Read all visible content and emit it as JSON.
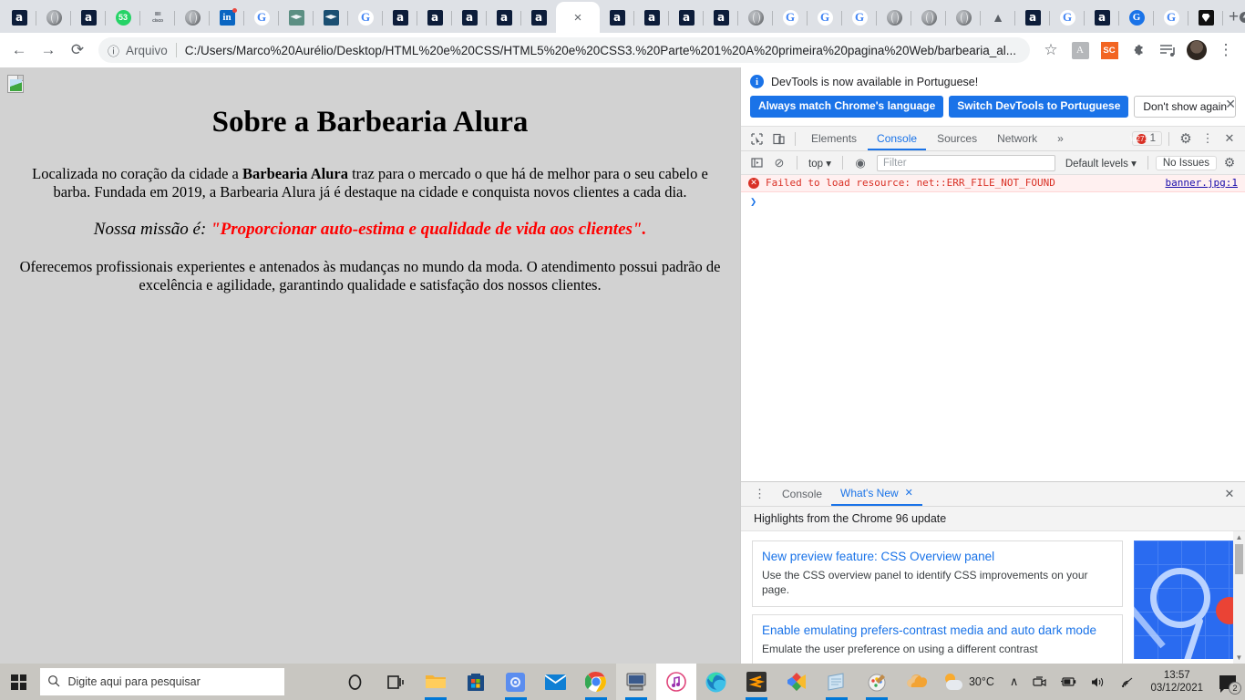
{
  "browser": {
    "tabs": [
      {
        "icon": "alura-favicon",
        "type": "alura",
        "label": "a"
      },
      {
        "icon": "globe-favicon",
        "type": "globe",
        "label": ""
      },
      {
        "icon": "alura-favicon",
        "type": "alura",
        "label": "a"
      },
      {
        "icon": "whatsapp-favicon",
        "type": "wa",
        "label": "53"
      },
      {
        "icon": "cisco-favicon",
        "type": "cisco",
        "label": "cisco"
      },
      {
        "icon": "globe-favicon",
        "type": "globe",
        "label": ""
      },
      {
        "icon": "linkedin-favicon",
        "type": "li",
        "label": "in"
      },
      {
        "icon": "google-favicon",
        "type": "google",
        "label": "G"
      },
      {
        "icon": "graduation-cap-favicon",
        "type": "cap1",
        "label": ""
      },
      {
        "icon": "graduation-cap-favicon",
        "type": "cap2",
        "label": ""
      },
      {
        "icon": "google-favicon",
        "type": "google",
        "label": "G"
      },
      {
        "icon": "alura-favicon",
        "type": "alura",
        "label": "a"
      },
      {
        "icon": "alura-favicon",
        "type": "alura",
        "label": "a"
      },
      {
        "icon": "alura-favicon",
        "type": "alura",
        "label": "a"
      },
      {
        "icon": "alura-favicon",
        "type": "alura",
        "label": "a"
      },
      {
        "icon": "alura-favicon",
        "type": "alura",
        "label": "a"
      },
      {
        "icon": "close-icon",
        "type": "active",
        "label": "×"
      },
      {
        "icon": "alura-favicon",
        "type": "alura",
        "label": "a"
      },
      {
        "icon": "alura-favicon",
        "type": "alura",
        "label": "a"
      },
      {
        "icon": "alura-favicon",
        "type": "alura",
        "label": "a"
      },
      {
        "icon": "alura-favicon",
        "type": "alura",
        "label": "a"
      },
      {
        "icon": "globe-favicon",
        "type": "globe",
        "label": ""
      },
      {
        "icon": "google-favicon",
        "type": "google",
        "label": "G"
      },
      {
        "icon": "google-favicon",
        "type": "google",
        "label": "G"
      },
      {
        "icon": "google-favicon",
        "type": "google",
        "label": "G"
      },
      {
        "icon": "globe-favicon",
        "type": "globe",
        "label": ""
      },
      {
        "icon": "globe-favicon",
        "type": "globe",
        "label": ""
      },
      {
        "icon": "globe-favicon",
        "type": "globe",
        "label": ""
      },
      {
        "icon": "moth-favicon",
        "type": "moth",
        "label": "▲"
      },
      {
        "icon": "alura-favicon",
        "type": "alura",
        "label": "a"
      },
      {
        "icon": "google-favicon",
        "type": "google",
        "label": "G"
      },
      {
        "icon": "alura-favicon",
        "type": "alura",
        "label": "a"
      },
      {
        "icon": "blue-g-favicon",
        "type": "blueg",
        "label": "G"
      },
      {
        "icon": "google-favicon",
        "type": "google",
        "label": "G"
      },
      {
        "icon": "dark-favicon",
        "type": "black",
        "label": ""
      }
    ],
    "new_tab_label": "+",
    "window_controls": {
      "minimize": "–",
      "maximize": "❐",
      "close": "✕"
    },
    "toolbar": {
      "back": "←",
      "forward": "→",
      "reload": "⟳",
      "info_icon": "ⓘ",
      "scheme_label": "Arquivo",
      "url": "C:/Users/Marco%20Aurélio/Desktop/HTML%20e%20CSS/HTML5%20e%20CSS3.%20Parte%201%20A%20primeira%20pagina%20Web/barbearia_al...",
      "bookmark": "☆",
      "ext_pdf": "⇊",
      "ext_sc": "SC",
      "ext_puzzle": "🧩",
      "ext_list": "≡",
      "menu": "⋮"
    }
  },
  "webpage": {
    "heading": "Sobre a Barbearia Alura",
    "paragraph1_a": "Localizada no coração da cidade a ",
    "paragraph1_b": "Barbearia Alura",
    "paragraph1_c": " traz para o mercado o que há de melhor para o seu cabelo e barba. Fundada em 2019, a Barbearia Alura já é destaque na cidade e conquista novos clientes a cada dia.",
    "mission_label": "Nossa missão é: ",
    "mission_quote": "\"Proporcionar auto-estima e qualidade de vida aos clientes\".",
    "paragraph2": "Oferecemos profissionais experientes e antenados às mudanças no mundo da moda. O atendimento possui padrão de excelência e agilidade, garantindo qualidade e satisfação dos nossos clientes.",
    "background_color": "#d2d2d2",
    "mission_color": "#ff0000"
  },
  "devtools": {
    "banner": {
      "message": "DevTools is now available in Portuguese!",
      "btn_always": "Always match Chrome's language",
      "btn_switch": "Switch DevTools to Portuguese",
      "btn_dismiss": "Don't show again",
      "close": "✕",
      "accent_color": "#1a73e8"
    },
    "tabs": [
      {
        "label": "Elements",
        "active": false
      },
      {
        "label": "Console",
        "active": true
      },
      {
        "label": "Sources",
        "active": false
      },
      {
        "label": "Network",
        "active": false
      }
    ],
    "more_tabs": "»",
    "inspect_icon": "⬚",
    "device_icon": "❐",
    "error_count": "1",
    "settings_icon": "⚙",
    "menu_icon": "⋮",
    "close_icon": "✕",
    "filterbar": {
      "sidebar_toggle": "◱",
      "clear_icon": "⊘",
      "context": "top",
      "context_caret": "▾",
      "eye_icon": "◉",
      "filter_placeholder": "Filter",
      "levels": "Default levels",
      "levels_caret": "▾",
      "issues": "No Issues",
      "gear": "⚙"
    },
    "console": {
      "error_text": "Failed to load resource: net::ERR_FILE_NOT_FOUND",
      "error_source": "banner.jpg:1",
      "prompt": "❯",
      "error_color": "#d93025"
    },
    "drawer": {
      "menu_dots": "⋮",
      "tabs": [
        {
          "label": "Console",
          "active": false,
          "closable": false
        },
        {
          "label": "What's New",
          "active": true,
          "closable": true
        }
      ],
      "close_tab_icon": "✕",
      "close_drawer_icon": "✕",
      "subtitle": "Highlights from the Chrome 96 update",
      "cards": [
        {
          "title": "New preview feature: CSS Overview panel",
          "desc": "Use the CSS overview panel to identify CSS improvements on your page."
        },
        {
          "title": "Enable emulating prefers-contrast media and auto dark mode",
          "desc": "Emulate the user preference on using a different contrast"
        }
      ],
      "scroll_up": "▲",
      "scroll_down": "▼"
    }
  },
  "taskbar": {
    "start_label": "Start",
    "search_placeholder": "Digite aqui para pesquisar",
    "search_icon": "⌕",
    "pinned": [
      {
        "name": "cortana-icon",
        "glyph": "◯"
      },
      {
        "name": "task-view-icon",
        "glyph": "⌸"
      },
      {
        "name": "file-explorer-icon",
        "glyph": ""
      },
      {
        "name": "microsoft-store-icon",
        "glyph": ""
      },
      {
        "name": "settings-icon",
        "glyph": "⚙"
      },
      {
        "name": "mail-icon",
        "glyph": ""
      },
      {
        "name": "app-icon",
        "glyph": ""
      },
      {
        "name": "chrome-icon",
        "glyph": ""
      },
      {
        "name": "remote-desktop-icon",
        "glyph": ""
      },
      {
        "name": "itunes-icon",
        "glyph": "♪"
      },
      {
        "name": "edge-icon",
        "glyph": ""
      },
      {
        "name": "sublime-text-icon",
        "glyph": "S"
      },
      {
        "name": "visual-studio-icon",
        "glyph": ""
      },
      {
        "name": "notepad-icon",
        "glyph": ""
      },
      {
        "name": "paint-icon",
        "glyph": ""
      },
      {
        "name": "onedrive-icon",
        "glyph": ""
      }
    ],
    "tray": {
      "temperature": "30°C",
      "chevron": "∧",
      "camera_icon": "□",
      "battery_icon": "▭",
      "volume_icon": "🔊",
      "network_icon": "◠",
      "time": "13:57",
      "date": "03/12/2021",
      "notification_count": "2"
    }
  }
}
